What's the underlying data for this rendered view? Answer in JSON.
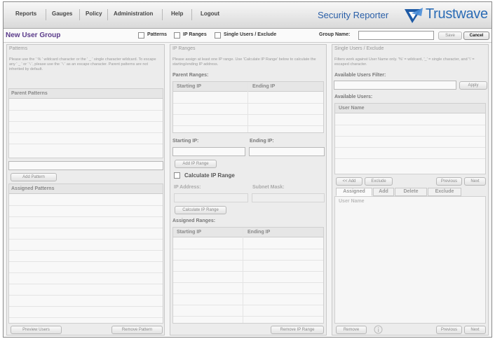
{
  "nav": {
    "items": [
      "Reports",
      "Gauges",
      "Policy",
      "Administration",
      "Help",
      "Logout"
    ]
  },
  "brand": {
    "product": "Security Reporter",
    "logo_text": "Trustwave"
  },
  "page": {
    "title": "New User Group",
    "toggles": [
      "Patterns",
      "IP Ranges",
      "Single Users / Exclude"
    ],
    "group_name_label": "Group Name:",
    "group_name_value": "",
    "save_label": "Save",
    "cancel_label": "Cancel"
  },
  "patterns": {
    "title": "Patterns",
    "help": "Please use the ' % ' wildcard character or the ' _ ' single character wildcard.  To escape any ' _ ' or ' \\ ', please use the ' \\ ' as an escape character.  Parent patterns are not inherited by default.",
    "parent_label": "Parent Patterns",
    "add_label": "Add Pattern",
    "assigned_label": "Assigned Patterns",
    "preview_label": "Preview Users",
    "remove_label": "Remove Pattern"
  },
  "ipranges": {
    "title": "IP Ranges",
    "help": "Please assign at least one IP range.  Use 'Calculate IP Range' below to calculate the starting/ending IP address.",
    "parent_label": "Parent Ranges:",
    "col_start": "Starting IP",
    "col_end": "Ending IP",
    "start_field_label": "Starting IP:",
    "end_field_label": "Ending IP:",
    "add_label": "Add IP Range",
    "calc_label": "Calculate IP Range",
    "ip_label": "IP Address:",
    "mask_label": "Subnet Mask:",
    "calc_button": "Calculate IP Range",
    "assigned_label": "Assigned Ranges:",
    "remove_label": "Remove IP Range"
  },
  "singleusers": {
    "title": "Single Users / Exclude",
    "help": "Filters work against User Name only.  '%' = wildcard, '_' = single character, and '\\' = escaped character.",
    "filter_label": "Available Users Filter:",
    "apply_label": "Apply",
    "available_label": "Available Users:",
    "col_user": "User Name",
    "add_btn": "<< Add",
    "exclude_btn": "Exclude",
    "prev_btn": "Previous",
    "next_btn": "Next",
    "tabs": [
      "Assigned",
      "Add",
      "Delete",
      "Exclude"
    ],
    "assigned_col": "User Name",
    "remove_btn": "Remove",
    "prev2_btn": "Previous",
    "next2_btn": "Next"
  },
  "colors": {
    "brand_blue": "#2b6cb5",
    "title_purple": "#5a3a8a"
  }
}
